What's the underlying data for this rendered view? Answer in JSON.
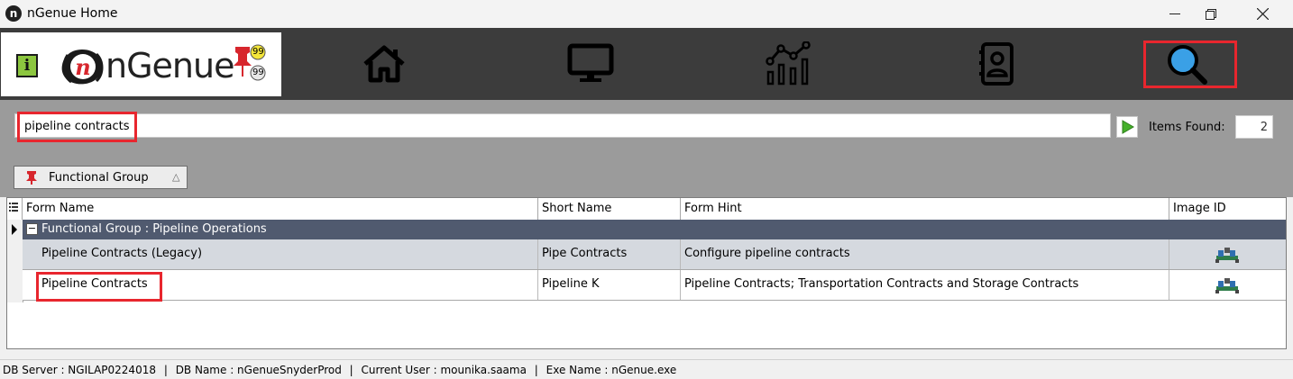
{
  "window": {
    "title": "nGenue Home",
    "app_icon_letter": "n"
  },
  "brand": {
    "name": "nGenue",
    "info_label": "i",
    "badge_top": "99",
    "badge_bottom": "99"
  },
  "nav": [
    "home-icon",
    "monitor-icon",
    "analytics-icon",
    "contacts-icon",
    "search-icon"
  ],
  "search": {
    "query": "pipeline contracts",
    "items_found_label": "Items Found:",
    "items_found_value": "2"
  },
  "group_chip": {
    "label": "Functional Group",
    "sort": "△"
  },
  "grid": {
    "columns": [
      "Form Name",
      "Short Name",
      "Form Hint",
      "Image ID"
    ],
    "group_row": {
      "toggle": "−",
      "label": "Functional Group : Pipeline Operations"
    },
    "rows": [
      {
        "form_name": "Pipeline Contracts (Legacy)",
        "short_name": "Pipe Contracts",
        "form_hint": "Configure pipeline contracts",
        "image": "pipeline-icon"
      },
      {
        "form_name": "Pipeline Contracts",
        "short_name": "Pipeline K",
        "form_hint": "Pipeline Contracts; Transportation Contracts and Storage Contracts",
        "image": "pipeline-icon"
      }
    ]
  },
  "status": {
    "db_server": "DB Server : NGILAP0224018",
    "db_name": "DB Name : nGenueSnyderProd",
    "current_user": "Current User : mounika.saama",
    "exe_name": "Exe Name : nGenue.exe",
    "separator": "|"
  },
  "colors": {
    "header_bg": "#3c3c3c",
    "highlight": "#e8262e",
    "group_row": "#505a6f",
    "search_icon": "#3aa0e6"
  }
}
